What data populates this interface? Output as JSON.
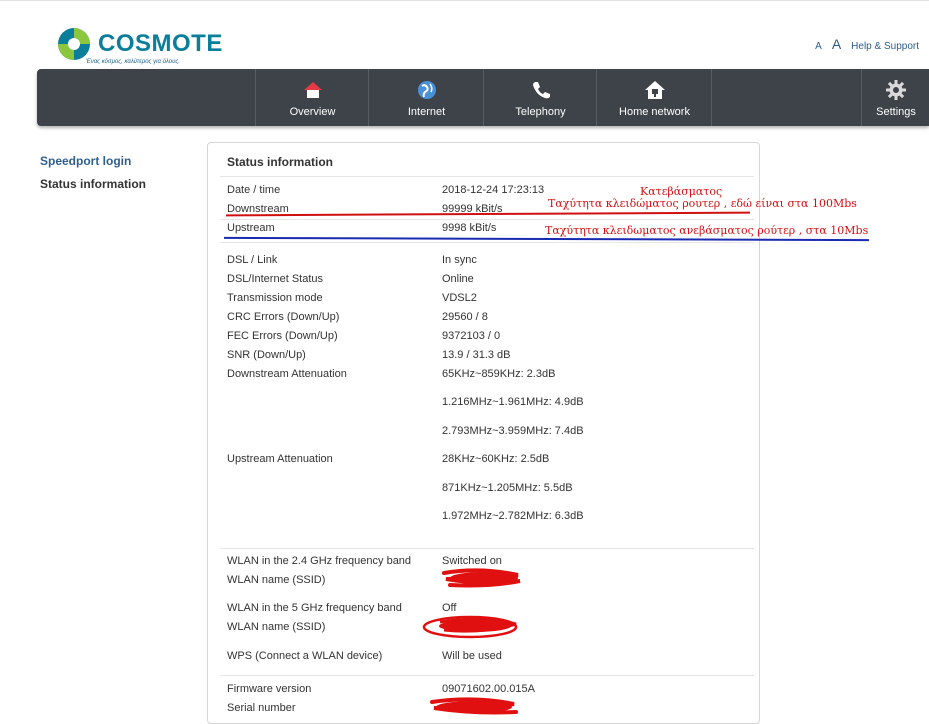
{
  "header": {
    "brand": "COSMOTE",
    "slogan": "Ένας κόσμος, καλύτερος για όλους.",
    "font_small": "A",
    "font_large": "A",
    "help_link": "Help & Support"
  },
  "nav": {
    "items": [
      {
        "label": "Overview",
        "icon": "home-icon"
      },
      {
        "label": "Internet",
        "icon": "globe-icon"
      },
      {
        "label": "Telephony",
        "icon": "phone-icon"
      },
      {
        "label": "Home network",
        "icon": "home-network-icon"
      },
      {
        "label": "Settings",
        "icon": "gear-icon"
      }
    ]
  },
  "sidebar": {
    "items": [
      {
        "label": "Speedport login"
      },
      {
        "label": "Status information"
      }
    ]
  },
  "status": {
    "title": "Status information",
    "rows": [
      {
        "label": "Date / time",
        "value": "2018-12-24 17:23:13"
      },
      {
        "label": "Downstream",
        "value": "99999 kBit/s"
      },
      {
        "label": "Upstream",
        "value": "9998 kBit/s"
      },
      {
        "label": "DSL / Link",
        "value": "In sync"
      },
      {
        "label": "DSL/Internet Status",
        "value": "Online"
      },
      {
        "label": "Transmission mode",
        "value": "VDSL2"
      },
      {
        "label": "CRC Errors (Down/Up)",
        "value": "29560 / 8"
      },
      {
        "label": "FEC Errors (Down/Up)",
        "value": "9372103 / 0"
      },
      {
        "label": "SNR (Down/Up)",
        "value": "13.9 / 31.3 dB"
      },
      {
        "label": "Downstream Attenuation",
        "value": "65KHz~859KHz: 2.3dB"
      },
      {
        "label": "",
        "value": "1.216MHz~1.961MHz: 4.9dB"
      },
      {
        "label": "",
        "value": "2.793MHz~3.959MHz: 7.4dB"
      },
      {
        "label": "Upstream Attenuation",
        "value": "28KHz~60KHz: 2.5dB"
      },
      {
        "label": "",
        "value": "871KHz~1.205MHz: 5.5dB"
      },
      {
        "label": "",
        "value": "1.972MHz~2.782MHz: 6.3dB"
      },
      {
        "label": "WLAN in the 2.4 GHz frequency band",
        "value": "Switched on"
      },
      {
        "label": "WLAN name (SSID)",
        "value": ""
      },
      {
        "label": "WLAN in the 5 GHz frequency band",
        "value": "Off"
      },
      {
        "label": "WLAN name (SSID)",
        "value": ""
      },
      {
        "label": "WPS (Connect a WLAN device)",
        "value": "Will be used"
      },
      {
        "label": "Firmware version",
        "value": "09071602.00.015A"
      },
      {
        "label": "Serial number",
        "value": ""
      }
    ]
  },
  "annotations": {
    "download_title": "Κατεβάσματος",
    "download_note": "Ταχύτητα κλειδώματος ρουτερ , εδώ είναι στα 100Mbs",
    "upload_note": "Ταχύτητα κλειδωματος ανεβάσματος ρούτερ , στα 10Mbs"
  },
  "colors": {
    "brand_teal": "#0b7e99",
    "navbar": "#3d4349",
    "link_blue": "#2f5f8f",
    "annotation_red": "#d01010",
    "annotation_blue": "#1a2bb0"
  }
}
